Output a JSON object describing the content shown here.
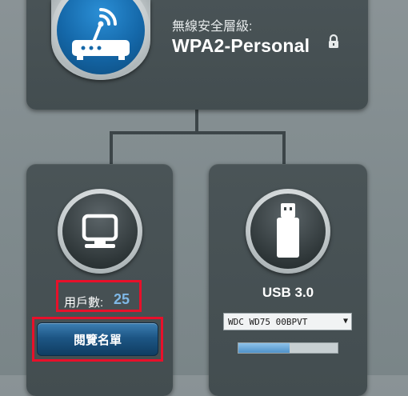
{
  "router": {
    "security_label": "無線安全層級:",
    "security_value": "WPA2-Personal",
    "lock_icon": "lock-icon",
    "router_icon": "wireless-router-icon"
  },
  "clients": {
    "label": "用戶數:",
    "count": "25",
    "view_list_button": "閱覽名單",
    "icon": "monitor-icon"
  },
  "usb": {
    "label": "USB 3.0",
    "device_selected": "WDC WD75 00BPVT",
    "icon": "usb-drive-icon",
    "usage_fraction": 0.52
  },
  "colors": {
    "highlight_box": "#e8102a",
    "accent_blue": "#7fb8e6",
    "button_blue": "#1d5685"
  }
}
